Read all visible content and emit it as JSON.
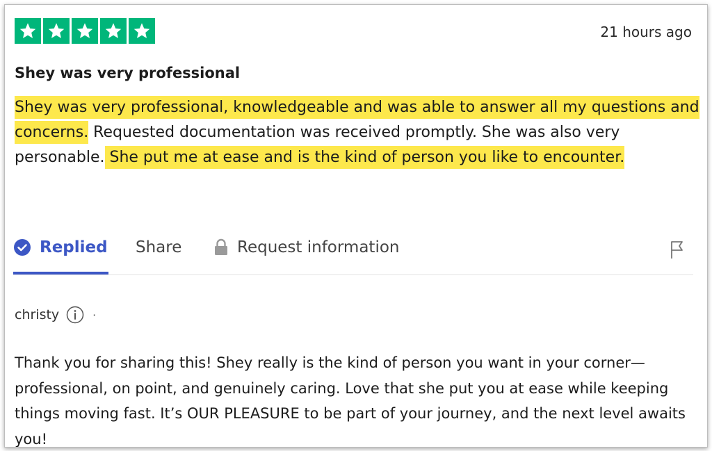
{
  "review": {
    "rating_stars": 5,
    "star_color": "#00b67a",
    "timestamp": "21 hours ago",
    "title": "Shey was very professional",
    "body": {
      "segment_1": "Shey was very professional, knowledgeable and was able to answer all my questions and concerns.",
      "segment_2": " Requested documentation was received promptly. She was also very personable.",
      "segment_3": " She put me at ease and is the kind of person you like to encounter."
    },
    "highlight_color": "#fde84c"
  },
  "actions": {
    "replied_label": "Replied",
    "share_label": "Share",
    "request_label": "Request information",
    "accent_color": "#3c57c5",
    "icons": [
      "check-circle-icon",
      "lock-icon",
      "flag-icon"
    ]
  },
  "reply": {
    "author": "christy",
    "separator": "·",
    "text": "Thank you for sharing this! Shey really is the kind of person you want in your corner—professional, on point, and genuinely caring. Love that she put you at ease while keeping things moving fast. It’s OUR PLEASURE to be part of your journey, and the next level awaits you!",
    "icons": [
      "info-icon"
    ]
  }
}
